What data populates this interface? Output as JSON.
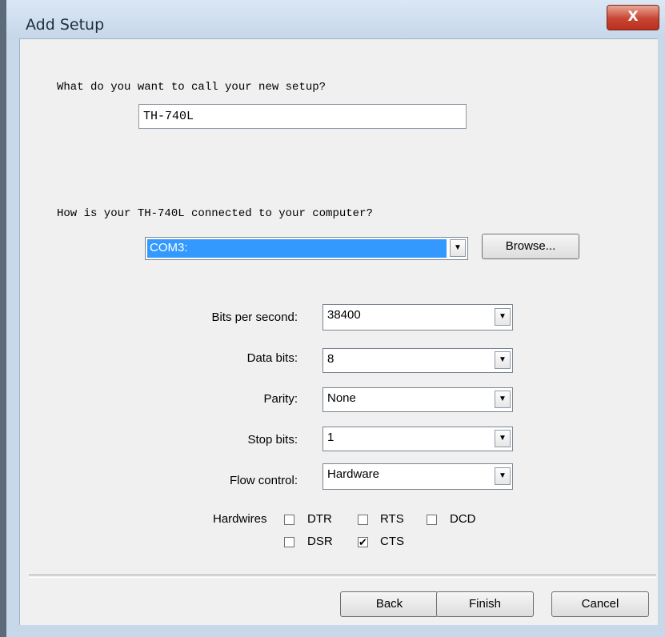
{
  "window": {
    "title": "Add Setup",
    "close_label": "X"
  },
  "setup_name": {
    "prompt": "What do you want to call your new setup?",
    "value": "TH-740L"
  },
  "connection": {
    "prompt": "How is your TH-740L connected to your computer?",
    "port_value": "COM3:",
    "browse_label": "Browse..."
  },
  "settings": {
    "bits_per_second": {
      "label": "Bits per second:",
      "value": "38400"
    },
    "data_bits": {
      "label": "Data bits:",
      "value": "8"
    },
    "parity": {
      "label": "Parity:",
      "value": "None"
    },
    "stop_bits": {
      "label": "Stop bits:",
      "value": "1"
    },
    "flow_control": {
      "label": "Flow control:",
      "value": "Hardware"
    }
  },
  "hardwires": {
    "label": "Hardwires",
    "options": [
      {
        "name": "DTR",
        "checked": false
      },
      {
        "name": "RTS",
        "checked": false
      },
      {
        "name": "DCD",
        "checked": false
      },
      {
        "name": "DSR",
        "checked": false
      },
      {
        "name": "CTS",
        "checked": true
      }
    ]
  },
  "buttons": {
    "back": "Back",
    "finish": "Finish",
    "cancel": "Cancel"
  },
  "colors": {
    "selection": "#3399ff",
    "close_button": "#c84432"
  }
}
